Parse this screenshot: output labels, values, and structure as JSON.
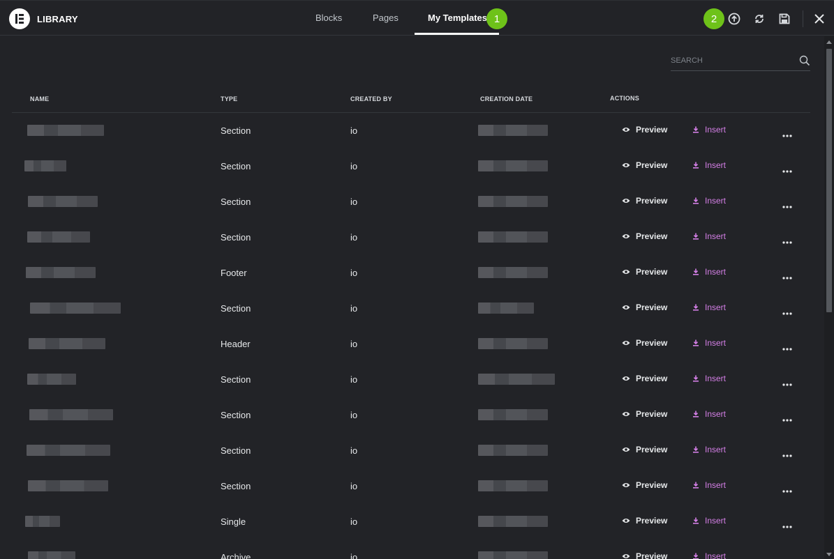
{
  "header": {
    "title": "LIBRARY",
    "tabs": [
      {
        "label": "Blocks"
      },
      {
        "label": "Pages"
      },
      {
        "label": "My Templates"
      }
    ],
    "badges": [
      "1",
      "2"
    ]
  },
  "search": {
    "placeholder": "SEARCH"
  },
  "table": {
    "columns": [
      "NAME",
      "TYPE",
      "CREATED BY",
      "CREATION DATE",
      "ACTIONS"
    ],
    "preview_label": "Preview",
    "insert_label": "Insert",
    "rows": [
      {
        "type": "Section",
        "created_by": "io"
      },
      {
        "type": "Section",
        "created_by": "io"
      },
      {
        "type": "Section",
        "created_by": "io"
      },
      {
        "type": "Section",
        "created_by": "io"
      },
      {
        "type": "Footer",
        "created_by": "io"
      },
      {
        "type": "Section",
        "created_by": "io"
      },
      {
        "type": "Header",
        "created_by": "io"
      },
      {
        "type": "Section",
        "created_by": "io"
      },
      {
        "type": "Section",
        "created_by": "io"
      },
      {
        "type": "Section",
        "created_by": "io"
      },
      {
        "type": "Section",
        "created_by": "io"
      },
      {
        "type": "Single",
        "created_by": "io"
      },
      {
        "type": "Archive",
        "created_by": "io"
      }
    ]
  },
  "colors": {
    "background": "#222327",
    "accent_insert": "#d47fe6",
    "badge": "#6ec219"
  }
}
